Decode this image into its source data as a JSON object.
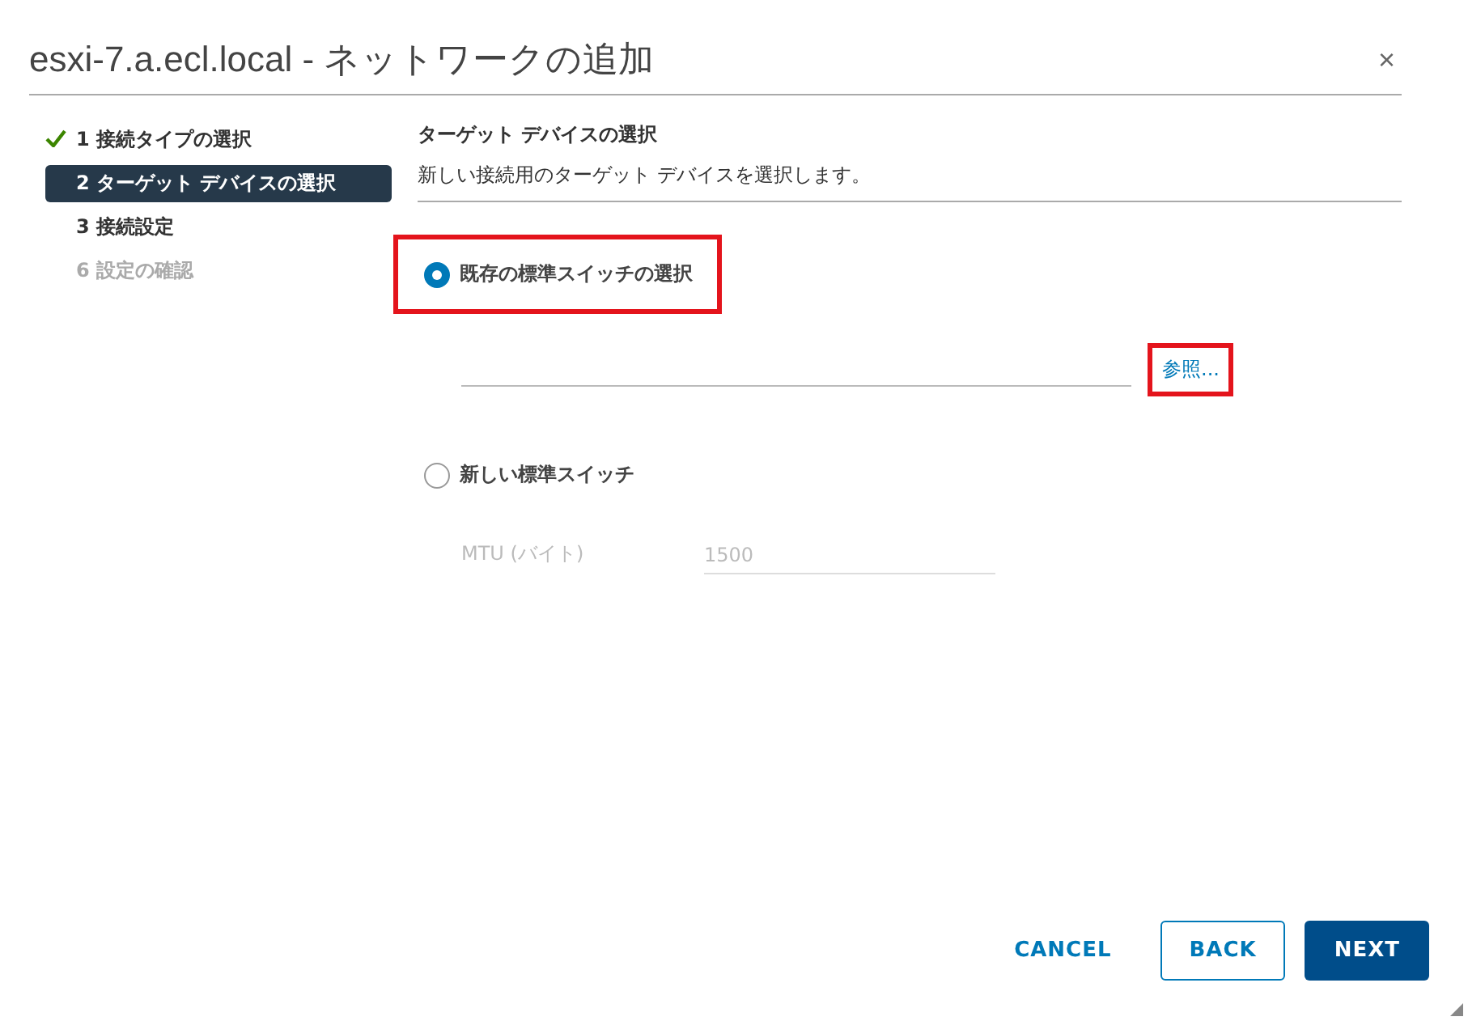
{
  "window": {
    "title": "esxi-7.a.ecl.local - ネットワークの追加",
    "close": "×"
  },
  "steps": [
    {
      "label": "1 接続タイプの選択",
      "done": true,
      "selected": false,
      "disabled": false
    },
    {
      "label": "2 ターゲット デバイスの選択",
      "done": false,
      "selected": true,
      "disabled": false
    },
    {
      "label": "3 接続設定",
      "done": false,
      "selected": false,
      "disabled": false
    },
    {
      "label": "6 設定の確認",
      "done": false,
      "selected": false,
      "disabled": true
    }
  ],
  "page": {
    "heading": "ターゲット デバイスの選択",
    "description": "新しい接続用のターゲット デバイスを選択します。"
  },
  "existing_switch": {
    "label": "既存の標準スイッチの選択",
    "selected": true,
    "highlighted": true,
    "browse": {
      "label": "参照...",
      "highlighted": true
    }
  },
  "new_switch": {
    "label": "新しい標準スイッチ",
    "selected": false,
    "mtu": {
      "label": "MTU (バイト)",
      "value": "1500",
      "disabled": true
    }
  },
  "buttons": [
    {
      "label": "CANCEL",
      "kind": "flat"
    },
    {
      "label": "BACK",
      "kind": "outline"
    },
    {
      "label": "NEXT",
      "kind": "primary"
    }
  ]
}
